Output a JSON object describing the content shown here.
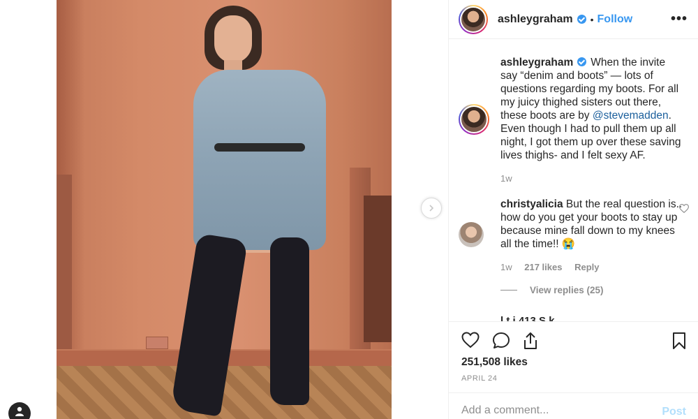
{
  "post": {
    "username": "ashleygraham",
    "follow_label": "Follow",
    "dot": "•",
    "more_label": "•••"
  },
  "caption": {
    "username": "ashleygraham",
    "text_before": "When the invite say “denim and boots” — lots of questions regarding my boots. For all my juicy thighed sisters out there, these boots are by ",
    "mention": "@stevemadden",
    "text_after": ". Even though I had to pull them up all night, I got them up over these saving lives thighs- and I felt sexy AF.",
    "time": "1w"
  },
  "comment": {
    "username": "christyalicia",
    "text": "But the real question is.. how do you get your boots to stay up because mine fall down to my knees all the time!! 😭",
    "time": "1w",
    "likes": "217 likes",
    "reply_label": "Reply",
    "view_replies": "View replies (25)"
  },
  "next_comment_partial": "l  t i  413 S        k",
  "likes_count": "251,508 likes",
  "date": "APRIL 24",
  "add_comment": {
    "placeholder": "Add a comment...",
    "post_label": "Post"
  },
  "colors": {
    "link": "#3897f0",
    "mention": "#1b5f9c",
    "muted": "#8e8e8e",
    "post_disabled": "#b2dffc",
    "wall": "#d48a68"
  },
  "icons": [
    "chevron-right-icon",
    "user-icon",
    "verified-icon",
    "more-icon",
    "heart-icon",
    "comment-icon",
    "share-icon",
    "bookmark-icon"
  ]
}
